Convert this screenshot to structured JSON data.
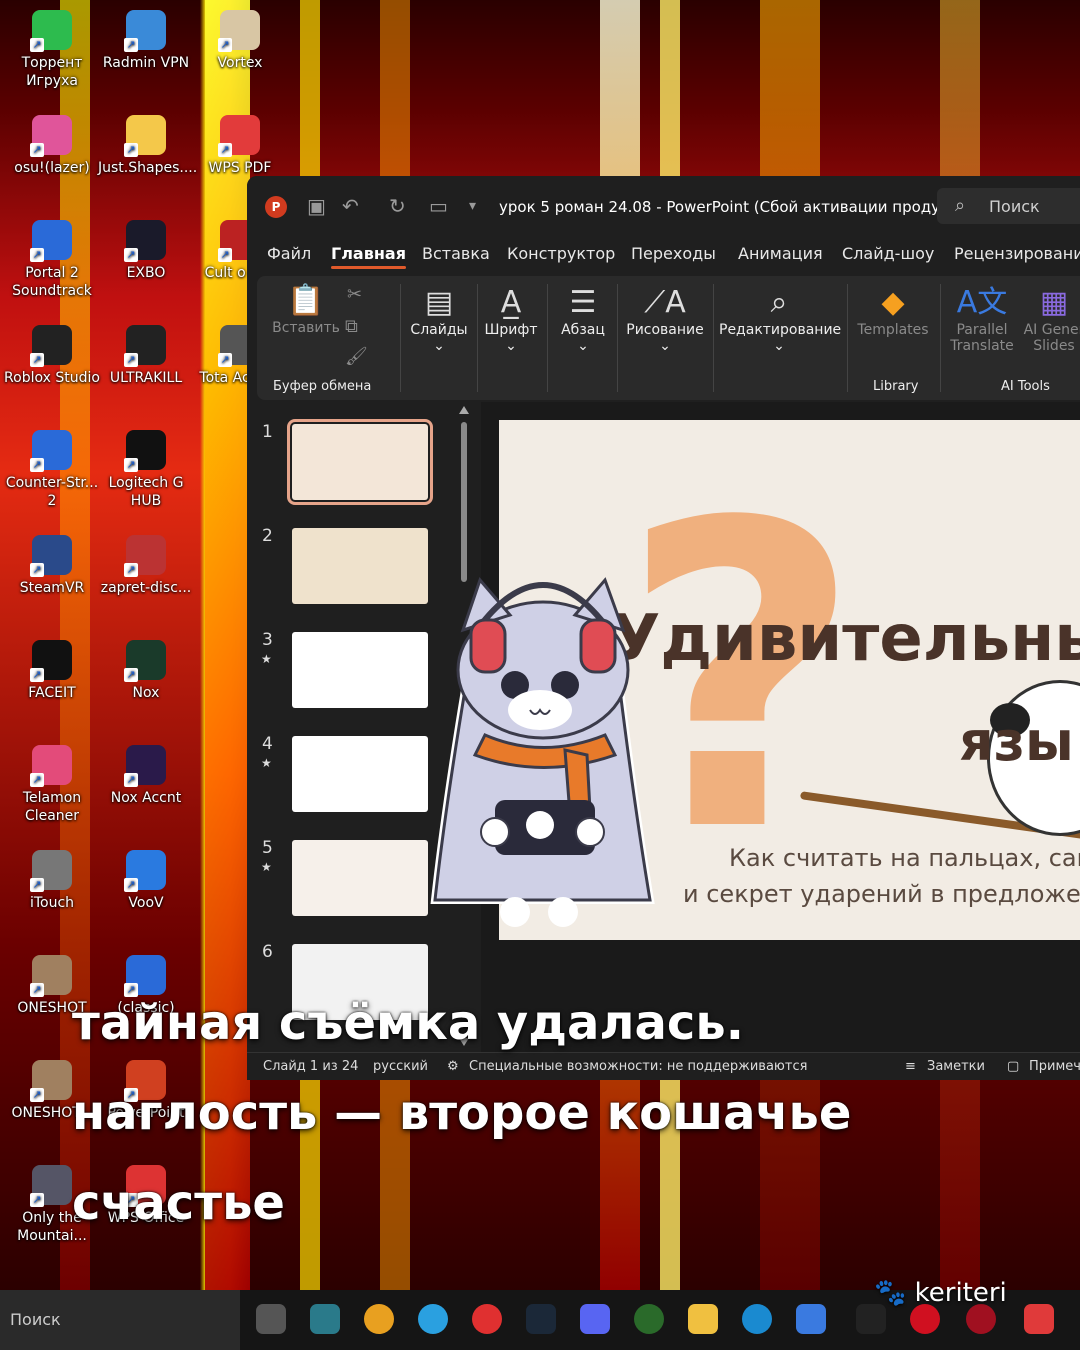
{
  "desktop": {
    "icons": [
      {
        "label": "Торрент Игруха",
        "color": "#2dbb4e"
      },
      {
        "label": "Radmin VPN",
        "color": "#3a8ad8"
      },
      {
        "label": "Vortex",
        "color": "#d8c6a4"
      },
      {
        "label": "osu!(lazer)",
        "color": "#e0559a"
      },
      {
        "label": "Just.Shapes....",
        "color": "#f4c84a"
      },
      {
        "label": "WPS PDF",
        "color": "#e23b3b"
      },
      {
        "label": "Portal 2 Soundtrack",
        "color": "#2a6ad8"
      },
      {
        "label": "EXBO",
        "color": "#1a1a2a"
      },
      {
        "label": "Cult o Lan",
        "color": "#b22"
      },
      {
        "label": "Roblox Studio",
        "color": "#222"
      },
      {
        "label": "ULTRAKILL",
        "color": "#222"
      },
      {
        "label": "Tota Accura",
        "color": "#555"
      },
      {
        "label": "Counter-Str... 2",
        "color": "#2a6ad8"
      },
      {
        "label": "Logitech G HUB",
        "color": "#111"
      },
      {
        "label": "SteamVR",
        "color": "#2a4a8a"
      },
      {
        "label": "zapret-disc...",
        "color": "#b33"
      },
      {
        "label": "FACEIT",
        "color": "#111"
      },
      {
        "label": "Nox",
        "color": "#1a3a2a"
      },
      {
        "label": "Telamon Cleaner",
        "color": "#e34b7a"
      },
      {
        "label": "Nox Accnt",
        "color": "#2a1a4a"
      },
      {
        "label": "iTouch",
        "color": "#777"
      },
      {
        "label": "VooV",
        "color": "#2a7ae0"
      },
      {
        "label": "ONESHOT",
        "color": "#a08060"
      },
      {
        "label": "(classic)",
        "color": "#2a6ad8"
      },
      {
        "label": "ONESHOT...",
        "color": "#a08060"
      },
      {
        "label": "PowerPoint",
        "color": "#d04020"
      },
      {
        "label": "Only the Mountai...",
        "color": "#556"
      },
      {
        "label": "WPS Office",
        "color": "#d33"
      }
    ]
  },
  "powerpoint": {
    "title": "урок 5 роман 24.08  -  PowerPoint (Сбой активации проду...",
    "search_label": "Поиск",
    "tabs": [
      "Файл",
      "Главная",
      "Вставка",
      "Конструктор",
      "Переходы",
      "Анимация",
      "Слайд-шоу",
      "Рецензирование"
    ],
    "ribbon": {
      "paste": "Вставить",
      "clipboard_group": "Буфер обмена",
      "slides": "Слайды",
      "font": "Шрифт",
      "paragraph": "Абзац",
      "drawing": "Рисование",
      "editing": "Редактирование",
      "templates": "Templates",
      "library_group": "Library",
      "parallel_translate": "Parallel Translate",
      "ai_generate": "AI Gener Slides",
      "ai_tools_group": "AI Tools"
    },
    "thumbnails": [
      {
        "num": "1",
        "star": ""
      },
      {
        "num": "2",
        "star": ""
      },
      {
        "num": "3",
        "star": "★"
      },
      {
        "num": "4",
        "star": "★"
      },
      {
        "num": "5",
        "star": "★"
      },
      {
        "num": "6",
        "star": ""
      }
    ],
    "slide": {
      "title_line1": "Удивительный",
      "title_line2": "язы",
      "subtitle_line1": "Как считать на пальцах, сам",
      "subtitle_line2": "и секрет ударений в предложен"
    },
    "status": {
      "slide_counter": "Слайд 1 из 24",
      "language": "русский",
      "accessibility": "Специальные возможности: не поддерживаются",
      "notes": "Заметки",
      "comments": "Примеч"
    }
  },
  "caption": {
    "line1": "тайная съёмка удалась.",
    "line2": "наглость — второе кошачье",
    "line3": "счастье"
  },
  "taskbar": {
    "search_label": "Поиск"
  },
  "watermark": "keriteri"
}
